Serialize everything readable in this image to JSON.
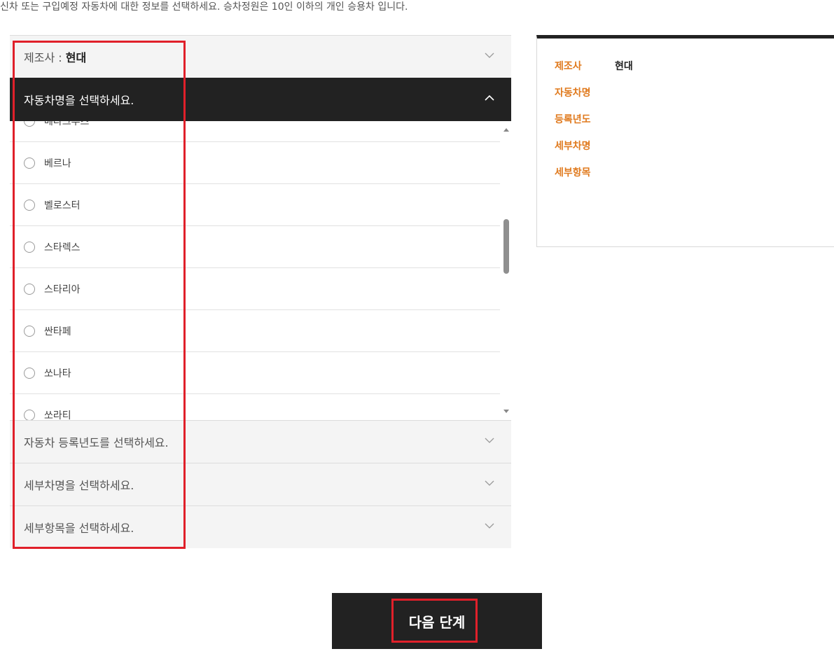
{
  "intro_text": "신차 또는 구입예정 자동차에 대한 정보를 선택하세요. 승차정원은 10인 이하의 개인 승용차 입니다.",
  "accordion": {
    "maker": {
      "label": "제조사 : ",
      "value": "현대"
    },
    "model_header": "자동차명을 선택하세요.",
    "models": [
      "베라크루즈",
      "베르나",
      "벨로스터",
      "스타렉스",
      "스타리아",
      "싼타페",
      "쏘나타",
      "쏘라티"
    ],
    "year_header": "자동차 등록년도를 선택하세요.",
    "detail_name_header": "세부차명을 선택하세요.",
    "detail_item_header": "세부항목을 선택하세요."
  },
  "summary": {
    "rows": [
      {
        "label": "제조사",
        "value": "현대"
      },
      {
        "label": "자동차명",
        "value": ""
      },
      {
        "label": "등록년도",
        "value": ""
      },
      {
        "label": "세부차명",
        "value": ""
      },
      {
        "label": "세부항목",
        "value": ""
      }
    ],
    "label_color": "#e07a1e"
  },
  "next_button": "다음 단계",
  "colors": {
    "dark": "#222222",
    "highlight": "#e0202a"
  }
}
